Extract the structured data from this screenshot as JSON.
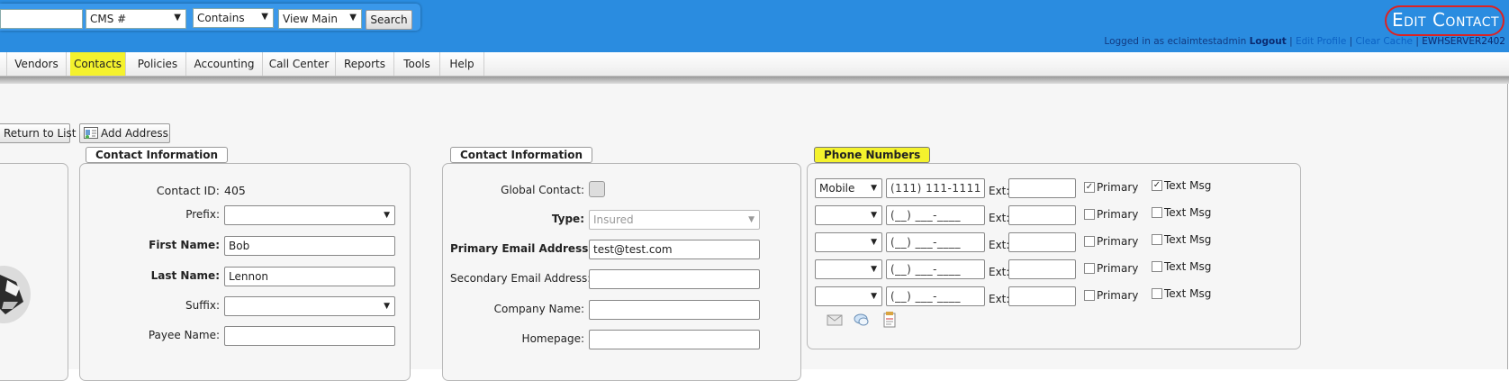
{
  "header": {
    "search_value": "",
    "search_type": "CMS #",
    "search_match": "Contains",
    "search_view": "View Main",
    "search_button": "Search",
    "page_title": "Edit Contact",
    "logged_in_text": "Logged in as eclaimtestadmin",
    "logout": "Logout",
    "edit_profile": "Edit Profile",
    "clear_cache": "Clear Cache",
    "server": "EWHSERVER2402",
    "separator": "|"
  },
  "menu": {
    "items": [
      "Vendors",
      "Contacts",
      "Policies",
      "Accounting",
      "Call Center",
      "Reports",
      "Tools",
      "Help"
    ],
    "active": "Contacts"
  },
  "toolbar": {
    "return_label": "Return to List",
    "add_address_label": "Add Address"
  },
  "panel1": {
    "legend": "Contact Information",
    "contact_id_label": "Contact ID:",
    "contact_id_value": "405",
    "prefix_label": "Prefix:",
    "prefix_value": "",
    "first_name_label": "First Name:",
    "first_name_value": "Bob",
    "last_name_label": "Last Name:",
    "last_name_value": "Lennon",
    "suffix_label": "Suffix:",
    "suffix_value": "",
    "payee_label": "Payee Name:",
    "payee_value": ""
  },
  "panel2": {
    "legend": "Contact Information",
    "global_label": "Global Contact:",
    "type_label": "Type:",
    "type_value": "Insured",
    "primary_email_label": "Primary Email Address:",
    "primary_email_value": "test@test.com",
    "secondary_email_label": "Secondary Email Address:",
    "secondary_email_value": "",
    "company_label": "Company Name:",
    "company_value": "",
    "homepage_label": "Homepage:",
    "homepage_value": ""
  },
  "phones": {
    "legend": "Phone Numbers",
    "ext_label": "Ext:",
    "primary_label": "Primary",
    "text_label": "Text Msg",
    "rows": [
      {
        "type": "Mobile",
        "number": "(111) 111-1111",
        "ext": "",
        "primary": "✓",
        "text": "✓"
      },
      {
        "type": "",
        "number": "(__) ___-____",
        "ext": "",
        "primary": "",
        "text": ""
      },
      {
        "type": "",
        "number": "(__) ___-____",
        "ext": "",
        "primary": "",
        "text": ""
      },
      {
        "type": "",
        "number": "(__) ___-____",
        "ext": "",
        "primary": "",
        "text": ""
      },
      {
        "type": "",
        "number": "(__) ___-____",
        "ext": "",
        "primary": "",
        "text": ""
      }
    ]
  },
  "icons": {
    "dropdown": "▼",
    "check": "✓"
  }
}
